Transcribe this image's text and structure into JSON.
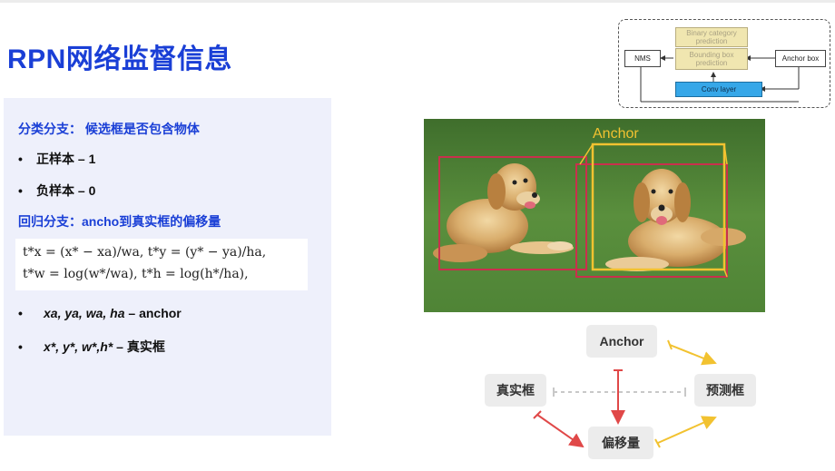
{
  "slide": {
    "title": "RPN网络监督信息"
  },
  "left_panel": {
    "cls_head": "分类分支： 候选框是否包含物体",
    "positive": "正样本 – 1",
    "negative": "负样本 – 0",
    "reg_head": "回归分支：ancho到真实框的偏移量",
    "formula_line1": "t*x = (x* − xa)/wa,    t*y = (y* − ya)/ha,",
    "formula_line2": "t*w = log(w*/wa),    t*h = log(h*/ha),",
    "anchor_vars": "xa, ya, wa, ha",
    "anchor_suffix": " – anchor",
    "gt_vars": "x*, y*, w*,h*",
    "gt_suffix": " – 真实框",
    "bullet": "•"
  },
  "photo": {
    "anchor_label": "Anchor"
  },
  "architecture": {
    "nms": "NMS",
    "binary": "Binary category prediction",
    "bbox": "Bounding box prediction",
    "anchor_box": "Anchor box",
    "conv": "Conv layer"
  },
  "flow": {
    "anchor": "Anchor",
    "gt": "真实框",
    "pred": "预测框",
    "offset": "偏移量"
  },
  "colors": {
    "title_blue": "#1a3fd6",
    "anchor_yellow": "#f2c230",
    "gt_red": "#c9304d",
    "arrow_red": "#e04848",
    "arrow_yellow": "#f2c230"
  }
}
